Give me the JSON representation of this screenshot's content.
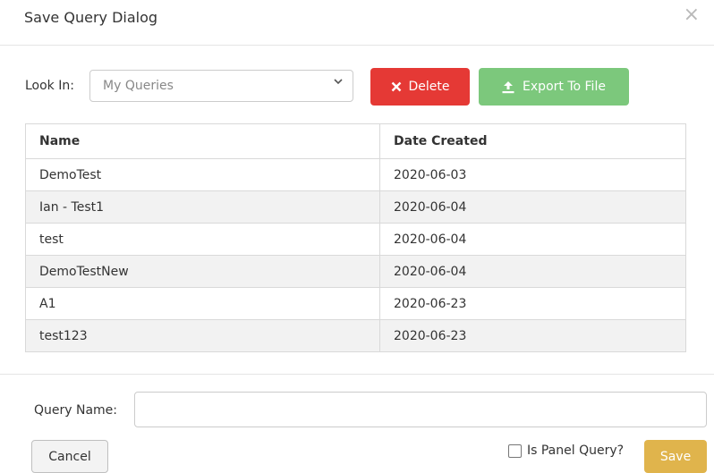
{
  "dialog": {
    "title": "Save Query Dialog",
    "close_glyph": "×"
  },
  "toolbar": {
    "look_in_label": "Look In:",
    "look_in_value": "My Queries",
    "delete_label": "Delete",
    "export_label": "Export To File"
  },
  "table": {
    "headers": [
      "Name",
      "Date Created"
    ],
    "rows": [
      [
        "DemoTest",
        "2020-06-03"
      ],
      [
        "Ian - Test1",
        "2020-06-04"
      ],
      [
        "test",
        "2020-06-04"
      ],
      [
        "DemoTestNew",
        "2020-06-04"
      ],
      [
        "A1",
        "2020-06-23"
      ],
      [
        "test123",
        "2020-06-23"
      ]
    ]
  },
  "footer": {
    "query_name_label": "Query Name:",
    "query_name_value": "",
    "cancel_label": "Cancel",
    "panel_query_label": "Is Panel Query?",
    "panel_query_checked": false,
    "save_label": "Save"
  },
  "colors": {
    "delete": "#e53935",
    "export": "#7cc87c",
    "save": "#e0b44c"
  },
  "icons": {
    "delete": "close-icon",
    "export": "upload-icon",
    "select": "chevron-down-icon"
  }
}
